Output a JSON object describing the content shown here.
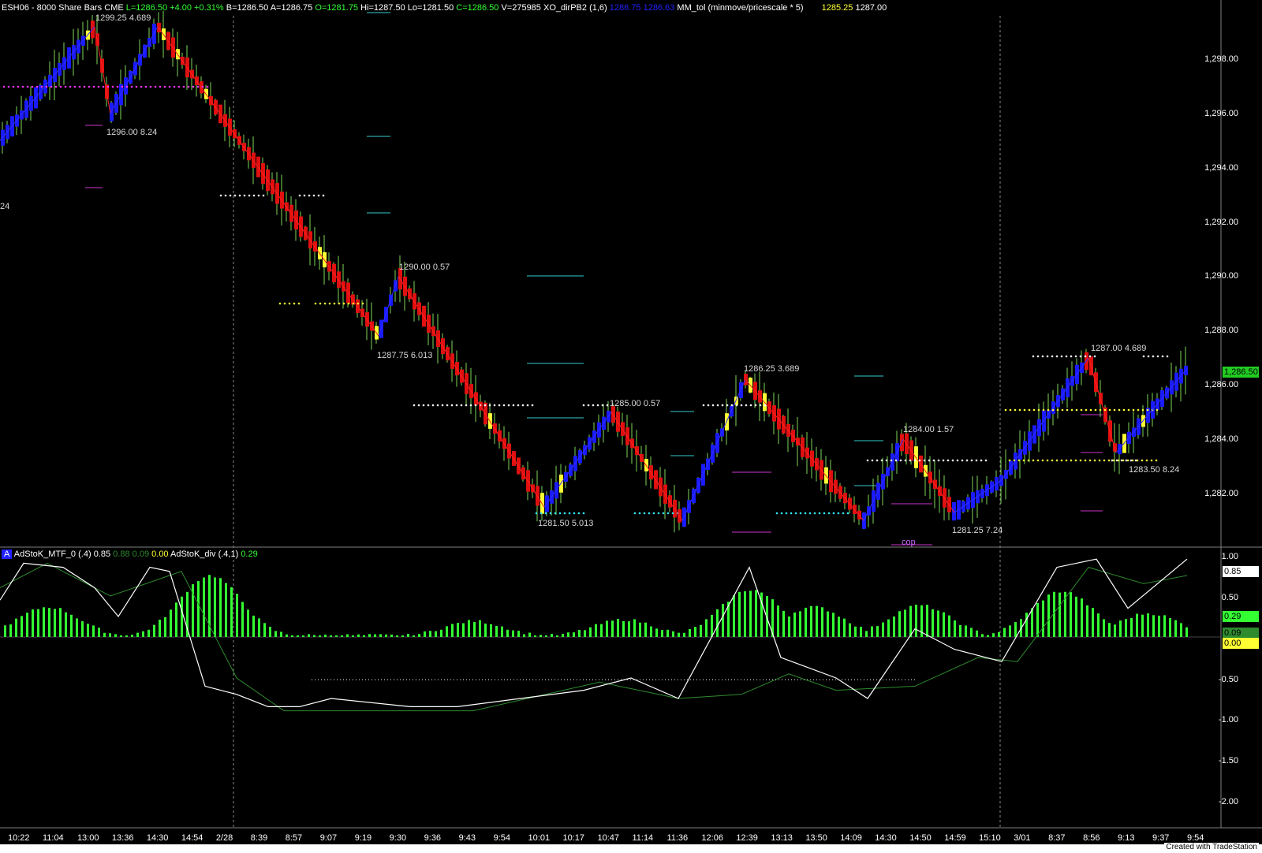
{
  "header": {
    "symbol": "ESH06 - 8000 Share Bars",
    "exchange": "CME",
    "last": "L=1286.50",
    "change": "+4.00",
    "change_pct": "+0.31%",
    "bid": "B=1286.50",
    "ask": "A=1286.75",
    "open": "O=1281.75",
    "high": "Hi=1287.50",
    "low": "Lo=1281.50",
    "close": "C=1286.50",
    "volume": "V=275985",
    "ind1_name": "XO_dirPB2",
    "ind1_params": "(1,6)",
    "ind1_v1": "1286.75",
    "ind1_v2": "1286.63",
    "ind2_name": "MM_tol",
    "ind2_params": "(minmove/pricescale * 5)",
    "ind2_v1": "1285.25",
    "ind2_v2": "1287.00"
  },
  "left_edge_label": "24",
  "price_axis": [
    "1,298.00",
    "1,296.00",
    "1,294.00",
    "1,292.00",
    "1,290.00",
    "1,288.00",
    "1,286.00",
    "1,284.00",
    "1,282.00"
  ],
  "price_badge": "1,286.50",
  "swing_labels": [
    "1299.25 4.689",
    "1296.00 8.24",
    "1290.00 0.57",
    "1287.75 6.013",
    "1286.25 3.689",
    "1285.00 0.57",
    "1284.00 1.57",
    "1281.50 5.013",
    "1281.25 7.24",
    "1287.00 4.689",
    "1283.50 8.24",
    "cop"
  ],
  "indicator_header": {
    "badge": "A",
    "name1": "AdStoK_MTF_0",
    "params1": "(.4)",
    "v1": "0.85",
    "v2": "0.88",
    "v3": "0.09",
    "v4": "0.00",
    "name2": "AdStoK_div",
    "params2": "(.4,1)",
    "v5": "0.29"
  },
  "osc_axis": [
    "1.00",
    "0.50",
    "-0.50",
    "-1.00",
    "-1.50",
    "-2.00"
  ],
  "osc_badges": {
    "white": "0.85",
    "green": "0.29",
    "dkgreen": "0.09",
    "yellow": "0.00"
  },
  "time_axis": [
    "10:22",
    "11:04",
    "13:00",
    "13:36",
    "14:30",
    "14:54",
    "2/28",
    "8:39",
    "8:57",
    "9:07",
    "9:19",
    "9:30",
    "9:36",
    "9:43",
    "9:54",
    "10:01",
    "10:17",
    "10:47",
    "11:14",
    "11:36",
    "12:06",
    "12:39",
    "13:13",
    "13:50",
    "14:09",
    "14:30",
    "14:50",
    "14:59",
    "15:10",
    "3/01",
    "8:37",
    "8:56",
    "9:13",
    "9:37",
    "9:54"
  ],
  "footer": "Created with TradeStation",
  "colors": {
    "up_bar": "#1a1aff",
    "down_bar": "#e01010",
    "wick": "#7ed957",
    "hist": "#33ff33",
    "stoch_fast": "#ffffff",
    "stoch_slow": "#2e8b2e",
    "dot_white": "#ffffff",
    "dot_yellow": "#ffff33",
    "dot_magenta": "#ff33ff",
    "dot_cyan": "#33e6ff",
    "level_cyan": "#33cccc",
    "level_magenta": "#cc33cc"
  }
}
